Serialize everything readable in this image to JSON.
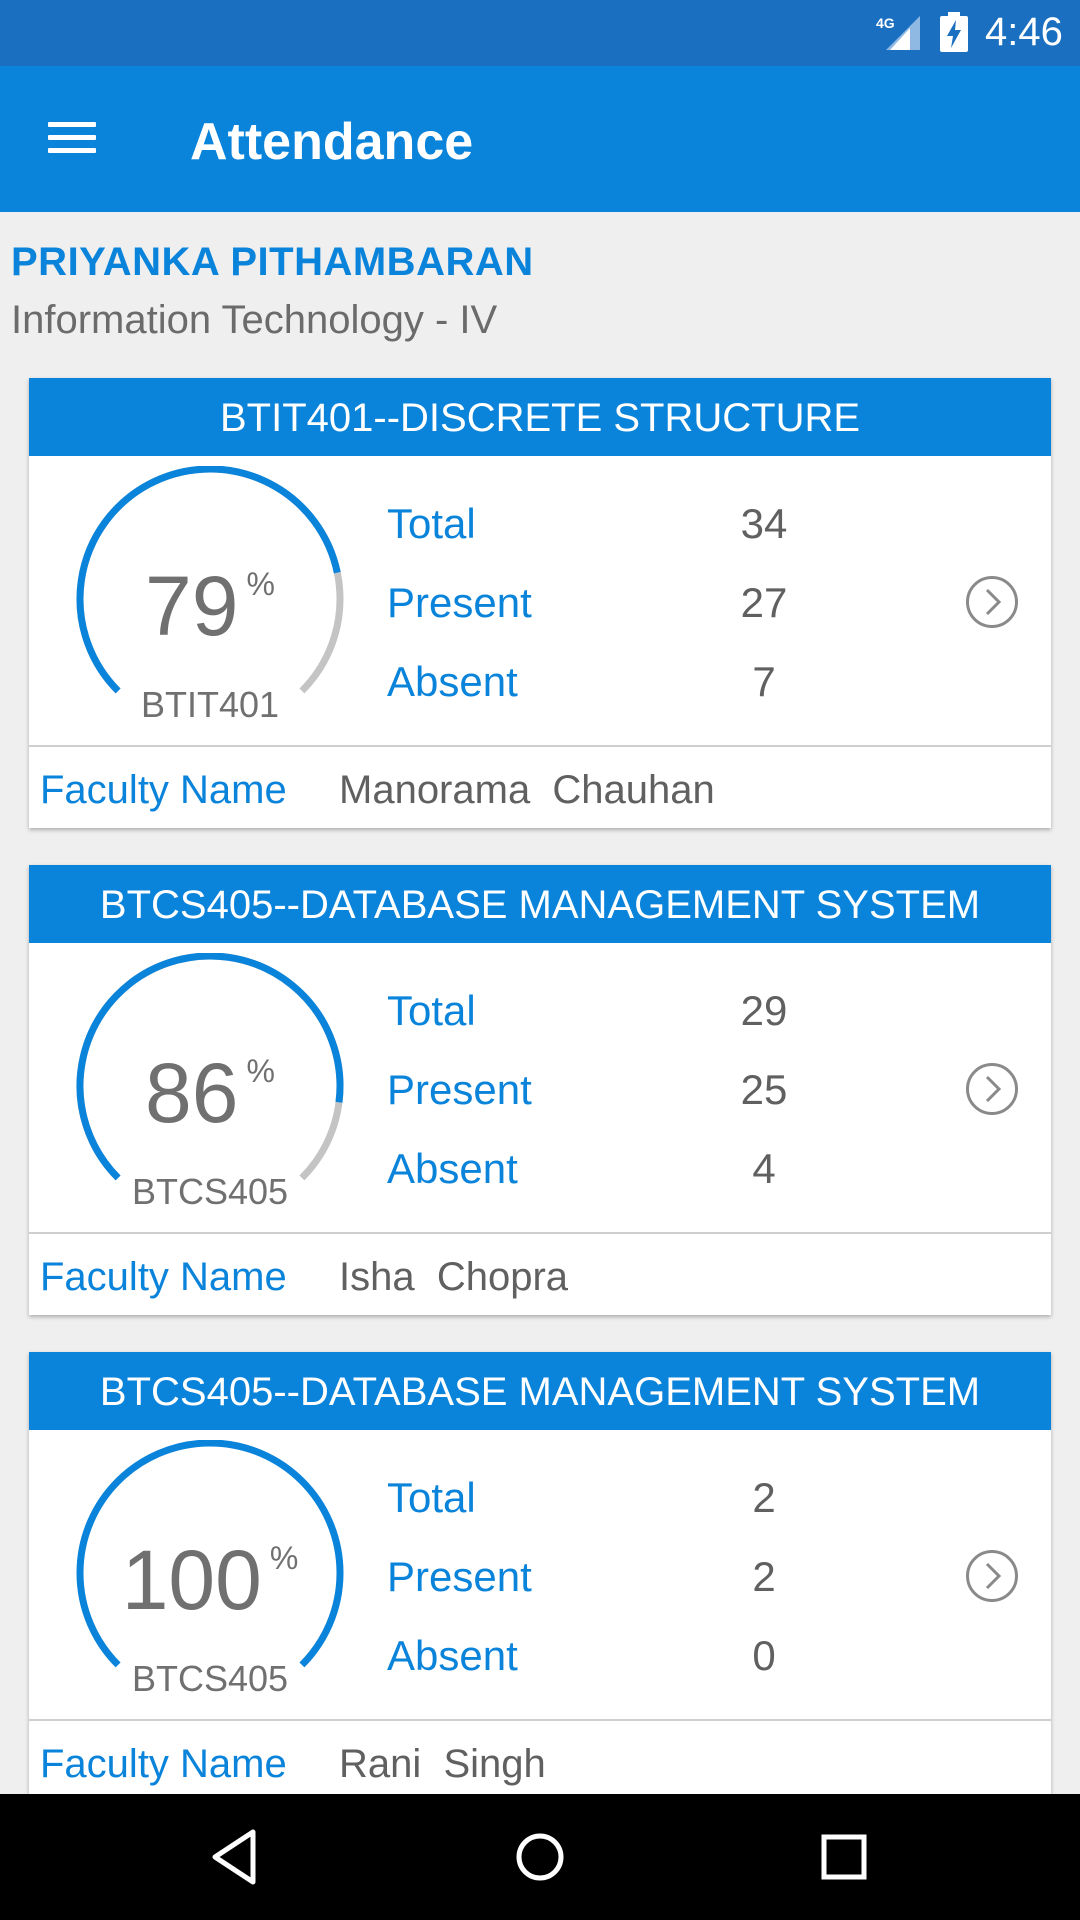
{
  "status_bar": {
    "network_label": "4G",
    "time": "4:46",
    "icons": [
      "signal-4g-icon",
      "battery-charging-icon"
    ]
  },
  "app_bar": {
    "menu_icon": "hamburger-menu-icon",
    "title": "Attendance"
  },
  "student": {
    "name": "PRIYANKA PITHAMBARAN",
    "department": "Information Technology - IV"
  },
  "labels": {
    "total": "Total",
    "present": "Present",
    "absent": "Absent",
    "faculty": "Faculty Name",
    "percent_sign": "%"
  },
  "courses": [
    {
      "title": "BTIT401--DISCRETE STRUCTURE",
      "code": "BTIT401",
      "percentage": "79",
      "percentage_fraction": 0.79,
      "total": "34",
      "present": "27",
      "absent": "7",
      "faculty_name": "Manorama  Chauhan"
    },
    {
      "title": "BTCS405--DATABASE MANAGEMENT SYSTEM",
      "code": "BTCS405",
      "percentage": "86",
      "percentage_fraction": 0.86,
      "total": "29",
      "present": "25",
      "absent": "4",
      "faculty_name": "Isha  Chopra"
    },
    {
      "title": "BTCS405--DATABASE MANAGEMENT SYSTEM",
      "code": "BTCS405",
      "percentage": "100",
      "percentage_fraction": 1.0,
      "total": "2",
      "present": "2",
      "absent": "0",
      "faculty_name": "Rani  Singh"
    }
  ],
  "colors": {
    "primary": "#0a83da",
    "status_bar": "#1a6fc0",
    "gauge_track": "#c4c4c4",
    "value_text": "#606060"
  },
  "nav_bar": {
    "icons": [
      "back-icon",
      "home-icon",
      "recents-icon"
    ]
  }
}
